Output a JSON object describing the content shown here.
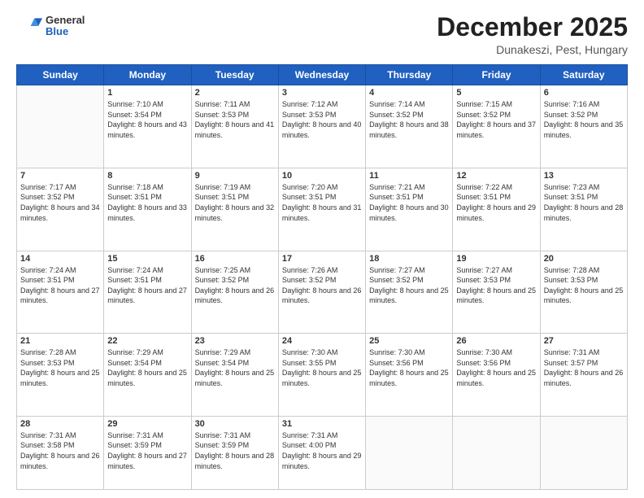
{
  "logo": {
    "general": "General",
    "blue": "Blue"
  },
  "header": {
    "month": "December 2025",
    "location": "Dunakeszi, Pest, Hungary"
  },
  "weekdays": [
    "Sunday",
    "Monday",
    "Tuesday",
    "Wednesday",
    "Thursday",
    "Friday",
    "Saturday"
  ],
  "weeks": [
    [
      {
        "day": "",
        "sunrise": "",
        "sunset": "",
        "daylight": ""
      },
      {
        "day": "1",
        "sunrise": "Sunrise: 7:10 AM",
        "sunset": "Sunset: 3:54 PM",
        "daylight": "Daylight: 8 hours and 43 minutes."
      },
      {
        "day": "2",
        "sunrise": "Sunrise: 7:11 AM",
        "sunset": "Sunset: 3:53 PM",
        "daylight": "Daylight: 8 hours and 41 minutes."
      },
      {
        "day": "3",
        "sunrise": "Sunrise: 7:12 AM",
        "sunset": "Sunset: 3:53 PM",
        "daylight": "Daylight: 8 hours and 40 minutes."
      },
      {
        "day": "4",
        "sunrise": "Sunrise: 7:14 AM",
        "sunset": "Sunset: 3:52 PM",
        "daylight": "Daylight: 8 hours and 38 minutes."
      },
      {
        "day": "5",
        "sunrise": "Sunrise: 7:15 AM",
        "sunset": "Sunset: 3:52 PM",
        "daylight": "Daylight: 8 hours and 37 minutes."
      },
      {
        "day": "6",
        "sunrise": "Sunrise: 7:16 AM",
        "sunset": "Sunset: 3:52 PM",
        "daylight": "Daylight: 8 hours and 35 minutes."
      }
    ],
    [
      {
        "day": "7",
        "sunrise": "Sunrise: 7:17 AM",
        "sunset": "Sunset: 3:52 PM",
        "daylight": "Daylight: 8 hours and 34 minutes."
      },
      {
        "day": "8",
        "sunrise": "Sunrise: 7:18 AM",
        "sunset": "Sunset: 3:51 PM",
        "daylight": "Daylight: 8 hours and 33 minutes."
      },
      {
        "day": "9",
        "sunrise": "Sunrise: 7:19 AM",
        "sunset": "Sunset: 3:51 PM",
        "daylight": "Daylight: 8 hours and 32 minutes."
      },
      {
        "day": "10",
        "sunrise": "Sunrise: 7:20 AM",
        "sunset": "Sunset: 3:51 PM",
        "daylight": "Daylight: 8 hours and 31 minutes."
      },
      {
        "day": "11",
        "sunrise": "Sunrise: 7:21 AM",
        "sunset": "Sunset: 3:51 PM",
        "daylight": "Daylight: 8 hours and 30 minutes."
      },
      {
        "day": "12",
        "sunrise": "Sunrise: 7:22 AM",
        "sunset": "Sunset: 3:51 PM",
        "daylight": "Daylight: 8 hours and 29 minutes."
      },
      {
        "day": "13",
        "sunrise": "Sunrise: 7:23 AM",
        "sunset": "Sunset: 3:51 PM",
        "daylight": "Daylight: 8 hours and 28 minutes."
      }
    ],
    [
      {
        "day": "14",
        "sunrise": "Sunrise: 7:24 AM",
        "sunset": "Sunset: 3:51 PM",
        "daylight": "Daylight: 8 hours and 27 minutes."
      },
      {
        "day": "15",
        "sunrise": "Sunrise: 7:24 AM",
        "sunset": "Sunset: 3:51 PM",
        "daylight": "Daylight: 8 hours and 27 minutes."
      },
      {
        "day": "16",
        "sunrise": "Sunrise: 7:25 AM",
        "sunset": "Sunset: 3:52 PM",
        "daylight": "Daylight: 8 hours and 26 minutes."
      },
      {
        "day": "17",
        "sunrise": "Sunrise: 7:26 AM",
        "sunset": "Sunset: 3:52 PM",
        "daylight": "Daylight: 8 hours and 26 minutes."
      },
      {
        "day": "18",
        "sunrise": "Sunrise: 7:27 AM",
        "sunset": "Sunset: 3:52 PM",
        "daylight": "Daylight: 8 hours and 25 minutes."
      },
      {
        "day": "19",
        "sunrise": "Sunrise: 7:27 AM",
        "sunset": "Sunset: 3:53 PM",
        "daylight": "Daylight: 8 hours and 25 minutes."
      },
      {
        "day": "20",
        "sunrise": "Sunrise: 7:28 AM",
        "sunset": "Sunset: 3:53 PM",
        "daylight": "Daylight: 8 hours and 25 minutes."
      }
    ],
    [
      {
        "day": "21",
        "sunrise": "Sunrise: 7:28 AM",
        "sunset": "Sunset: 3:53 PM",
        "daylight": "Daylight: 8 hours and 25 minutes."
      },
      {
        "day": "22",
        "sunrise": "Sunrise: 7:29 AM",
        "sunset": "Sunset: 3:54 PM",
        "daylight": "Daylight: 8 hours and 25 minutes."
      },
      {
        "day": "23",
        "sunrise": "Sunrise: 7:29 AM",
        "sunset": "Sunset: 3:54 PM",
        "daylight": "Daylight: 8 hours and 25 minutes."
      },
      {
        "day": "24",
        "sunrise": "Sunrise: 7:30 AM",
        "sunset": "Sunset: 3:55 PM",
        "daylight": "Daylight: 8 hours and 25 minutes."
      },
      {
        "day": "25",
        "sunrise": "Sunrise: 7:30 AM",
        "sunset": "Sunset: 3:56 PM",
        "daylight": "Daylight: 8 hours and 25 minutes."
      },
      {
        "day": "26",
        "sunrise": "Sunrise: 7:30 AM",
        "sunset": "Sunset: 3:56 PM",
        "daylight": "Daylight: 8 hours and 25 minutes."
      },
      {
        "day": "27",
        "sunrise": "Sunrise: 7:31 AM",
        "sunset": "Sunset: 3:57 PM",
        "daylight": "Daylight: 8 hours and 26 minutes."
      }
    ],
    [
      {
        "day": "28",
        "sunrise": "Sunrise: 7:31 AM",
        "sunset": "Sunset: 3:58 PM",
        "daylight": "Daylight: 8 hours and 26 minutes."
      },
      {
        "day": "29",
        "sunrise": "Sunrise: 7:31 AM",
        "sunset": "Sunset: 3:59 PM",
        "daylight": "Daylight: 8 hours and 27 minutes."
      },
      {
        "day": "30",
        "sunrise": "Sunrise: 7:31 AM",
        "sunset": "Sunset: 3:59 PM",
        "daylight": "Daylight: 8 hours and 28 minutes."
      },
      {
        "day": "31",
        "sunrise": "Sunrise: 7:31 AM",
        "sunset": "Sunset: 4:00 PM",
        "daylight": "Daylight: 8 hours and 29 minutes."
      },
      {
        "day": "",
        "sunrise": "",
        "sunset": "",
        "daylight": ""
      },
      {
        "day": "",
        "sunrise": "",
        "sunset": "",
        "daylight": ""
      },
      {
        "day": "",
        "sunrise": "",
        "sunset": "",
        "daylight": ""
      }
    ]
  ]
}
